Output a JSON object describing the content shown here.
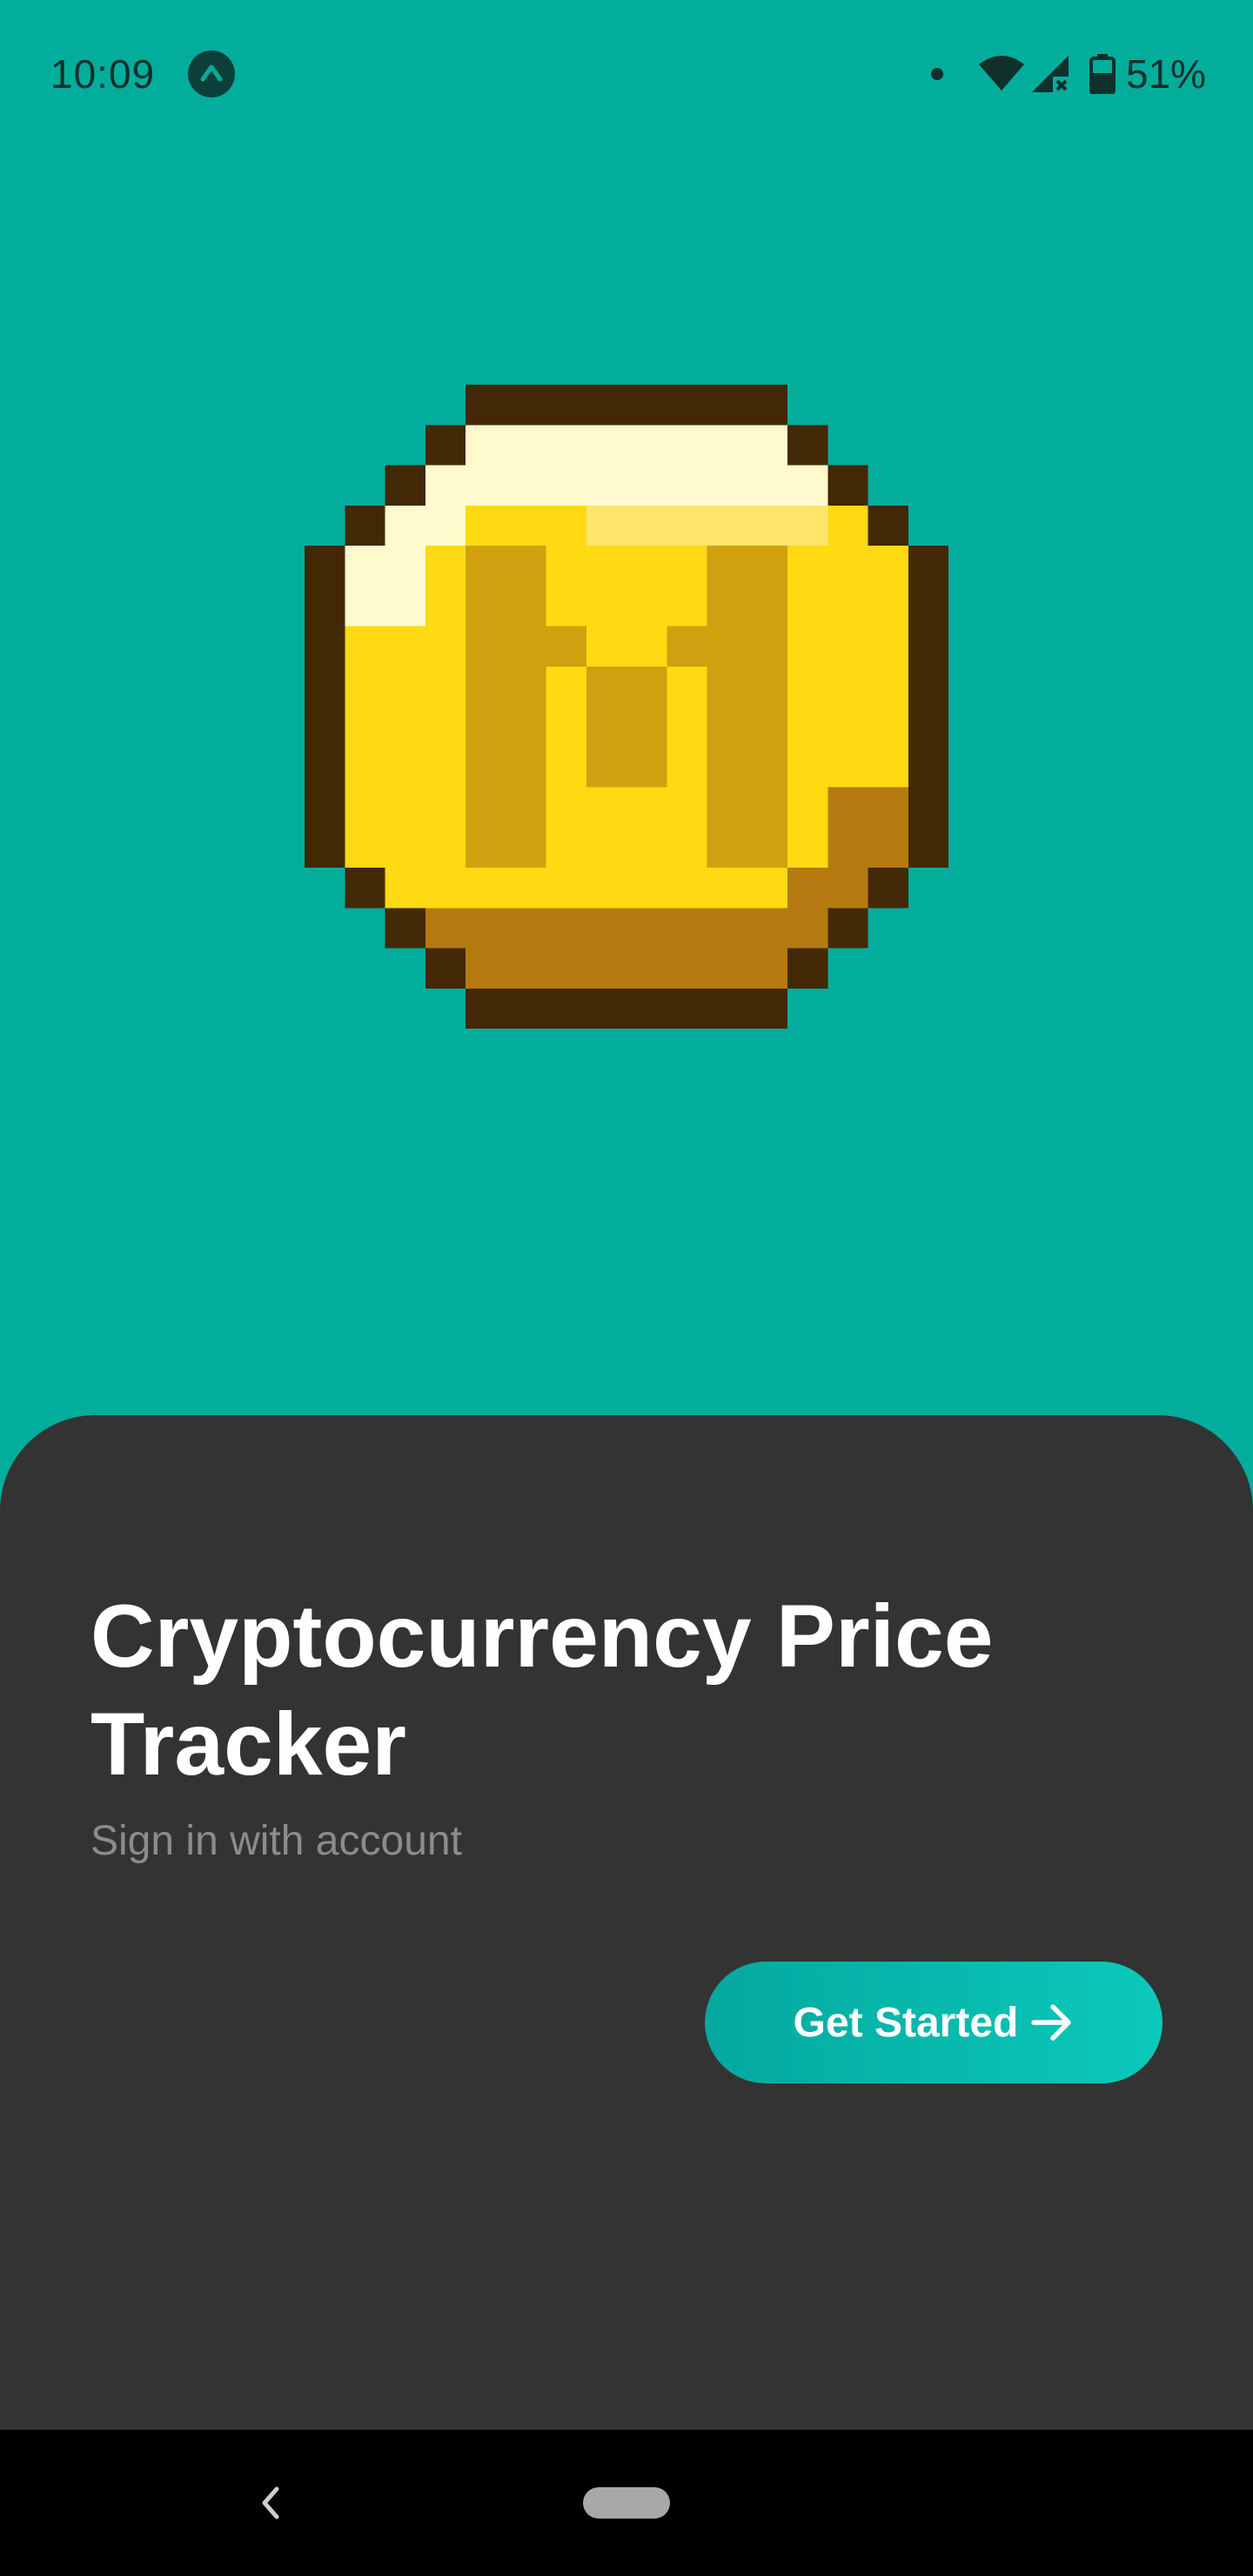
{
  "status_bar": {
    "time": "10:09",
    "battery_percent": "51%",
    "icons": [
      "app-notification-icon",
      "dot-icon",
      "wifi-icon",
      "signal-icon",
      "battery-icon"
    ]
  },
  "hero": {
    "logo": "pixel-coin-icon"
  },
  "sheet": {
    "title": "Cryptocurrency Price Tracker",
    "subtitle": "Sign in with account",
    "cta_label": "Get Started",
    "cta_icon": "arrow-right-icon"
  },
  "nav_bar": {
    "icons": [
      "back-icon",
      "home-pill-icon"
    ]
  },
  "colors": {
    "background": "#03AD9C",
    "sheet": "#333333",
    "button_start": "#04A89E",
    "button_end": "#0BC9BB",
    "subtitle": "#8C8C8C",
    "coin_outline": "#432806",
    "coin_gold": "#FDDA12",
    "coin_highlight": "#FFFACD",
    "coin_shade": "#B47A10",
    "coin_mark": "#D0A00E"
  }
}
